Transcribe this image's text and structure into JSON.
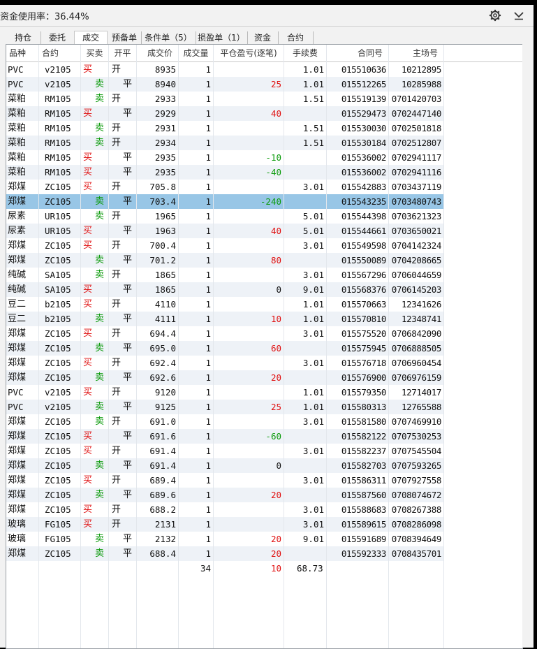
{
  "window": {
    "title": "资金使用率：36.44%",
    "icons": [
      "gear-icon",
      "chevron-down-icon"
    ]
  },
  "tabs": [
    {
      "label": "持仓",
      "active": false
    },
    {
      "label": "委托",
      "active": false
    },
    {
      "label": "成交",
      "active": true
    },
    {
      "label": "预备单",
      "active": false
    },
    {
      "label": "条件单（5）",
      "active": false
    },
    {
      "label": "损盈单（1）",
      "active": false
    },
    {
      "label": "资金",
      "active": false
    },
    {
      "label": "合约",
      "active": false
    }
  ],
  "table": {
    "columns": [
      "品种",
      "合约",
      "买卖",
      "开平",
      "成交价",
      "成交量",
      "平仓盈亏(逐笔)",
      "手续费",
      "合同号",
      "主场号"
    ],
    "rows": [
      {
        "product": "PVC",
        "contract": "v2105",
        "side": "买",
        "oc": "开",
        "price": "8935",
        "qty": "1",
        "pnl": "",
        "fee": "1.01",
        "order_no": "015510636",
        "match_no": "10212895"
      },
      {
        "product": "PVC",
        "contract": "v2105",
        "side": "卖",
        "oc": "平",
        "price": "8940",
        "qty": "1",
        "pnl": "25",
        "fee": "1.01",
        "order_no": "015512265",
        "match_no": "10285988"
      },
      {
        "product": "菜粕",
        "contract": "RM105",
        "side": "卖",
        "oc": "开",
        "price": "2933",
        "qty": "1",
        "pnl": "",
        "fee": "1.51",
        "order_no": "015519139",
        "match_no": "0701420703"
      },
      {
        "product": "菜粕",
        "contract": "RM105",
        "side": "买",
        "oc": "平",
        "price": "2929",
        "qty": "1",
        "pnl": "40",
        "fee": "",
        "order_no": "015529473",
        "match_no": "0702447140"
      },
      {
        "product": "菜粕",
        "contract": "RM105",
        "side": "卖",
        "oc": "开",
        "price": "2931",
        "qty": "1",
        "pnl": "",
        "fee": "1.51",
        "order_no": "015530030",
        "match_no": "0702501818"
      },
      {
        "product": "菜粕",
        "contract": "RM105",
        "side": "卖",
        "oc": "开",
        "price": "2934",
        "qty": "1",
        "pnl": "",
        "fee": "1.51",
        "order_no": "015530184",
        "match_no": "0702512807"
      },
      {
        "product": "菜粕",
        "contract": "RM105",
        "side": "买",
        "oc": "平",
        "price": "2935",
        "qty": "1",
        "pnl": "-10",
        "fee": "",
        "order_no": "015536002",
        "match_no": "0702941117"
      },
      {
        "product": "菜粕",
        "contract": "RM105",
        "side": "买",
        "oc": "平",
        "price": "2935",
        "qty": "1",
        "pnl": "-40",
        "fee": "",
        "order_no": "015536002",
        "match_no": "0702941116"
      },
      {
        "product": "郑煤",
        "contract": "ZC105",
        "side": "买",
        "oc": "开",
        "price": "705.8",
        "qty": "1",
        "pnl": "",
        "fee": "3.01",
        "order_no": "015542883",
        "match_no": "0703437119"
      },
      {
        "product": "郑煤",
        "contract": "ZC105",
        "side": "卖",
        "oc": "平",
        "price": "703.4",
        "qty": "1",
        "pnl": "-240",
        "fee": "",
        "order_no": "015543235",
        "match_no": "0703480743",
        "selected": true
      },
      {
        "product": "尿素",
        "contract": "UR105",
        "side": "卖",
        "oc": "开",
        "price": "1965",
        "qty": "1",
        "pnl": "",
        "fee": "5.01",
        "order_no": "015544398",
        "match_no": "0703621323"
      },
      {
        "product": "尿素",
        "contract": "UR105",
        "side": "买",
        "oc": "平",
        "price": "1963",
        "qty": "1",
        "pnl": "40",
        "fee": "5.01",
        "order_no": "015544661",
        "match_no": "0703650021"
      },
      {
        "product": "郑煤",
        "contract": "ZC105",
        "side": "买",
        "oc": "开",
        "price": "700.4",
        "qty": "1",
        "pnl": "",
        "fee": "3.01",
        "order_no": "015549598",
        "match_no": "0704142324"
      },
      {
        "product": "郑煤",
        "contract": "ZC105",
        "side": "卖",
        "oc": "平",
        "price": "701.2",
        "qty": "1",
        "pnl": "80",
        "fee": "",
        "order_no": "015550089",
        "match_no": "0704208665"
      },
      {
        "product": "纯碱",
        "contract": "SA105",
        "side": "卖",
        "oc": "开",
        "price": "1865",
        "qty": "1",
        "pnl": "",
        "fee": "3.01",
        "order_no": "015567296",
        "match_no": "0706044659"
      },
      {
        "product": "纯碱",
        "contract": "SA105",
        "side": "买",
        "oc": "平",
        "price": "1865",
        "qty": "1",
        "pnl": "0",
        "fee": "9.01",
        "order_no": "015568376",
        "match_no": "0706145203"
      },
      {
        "product": "豆二",
        "contract": "b2105",
        "side": "买",
        "oc": "开",
        "price": "4110",
        "qty": "1",
        "pnl": "",
        "fee": "1.01",
        "order_no": "015570663",
        "match_no": "12341626"
      },
      {
        "product": "豆二",
        "contract": "b2105",
        "side": "卖",
        "oc": "平",
        "price": "4111",
        "qty": "1",
        "pnl": "10",
        "fee": "1.01",
        "order_no": "015570810",
        "match_no": "12348741"
      },
      {
        "product": "郑煤",
        "contract": "ZC105",
        "side": "买",
        "oc": "开",
        "price": "694.4",
        "qty": "1",
        "pnl": "",
        "fee": "3.01",
        "order_no": "015575520",
        "match_no": "0706842090"
      },
      {
        "product": "郑煤",
        "contract": "ZC105",
        "side": "卖",
        "oc": "平",
        "price": "695.0",
        "qty": "1",
        "pnl": "60",
        "fee": "",
        "order_no": "015575945",
        "match_no": "0706888505"
      },
      {
        "product": "郑煤",
        "contract": "ZC105",
        "side": "买",
        "oc": "开",
        "price": "692.4",
        "qty": "1",
        "pnl": "",
        "fee": "3.01",
        "order_no": "015576718",
        "match_no": "0706960454"
      },
      {
        "product": "郑煤",
        "contract": "ZC105",
        "side": "卖",
        "oc": "平",
        "price": "692.6",
        "qty": "1",
        "pnl": "20",
        "fee": "",
        "order_no": "015576900",
        "match_no": "0706976159"
      },
      {
        "product": "PVC",
        "contract": "v2105",
        "side": "买",
        "oc": "开",
        "price": "9120",
        "qty": "1",
        "pnl": "",
        "fee": "1.01",
        "order_no": "015579350",
        "match_no": "12714017"
      },
      {
        "product": "PVC",
        "contract": "v2105",
        "side": "卖",
        "oc": "平",
        "price": "9125",
        "qty": "1",
        "pnl": "25",
        "fee": "1.01",
        "order_no": "015580313",
        "match_no": "12765588"
      },
      {
        "product": "郑煤",
        "contract": "ZC105",
        "side": "卖",
        "oc": "开",
        "price": "691.0",
        "qty": "1",
        "pnl": "",
        "fee": "3.01",
        "order_no": "015581580",
        "match_no": "0707469910"
      },
      {
        "product": "郑煤",
        "contract": "ZC105",
        "side": "买",
        "oc": "平",
        "price": "691.6",
        "qty": "1",
        "pnl": "-60",
        "fee": "",
        "order_no": "015582122",
        "match_no": "0707530253"
      },
      {
        "product": "郑煤",
        "contract": "ZC105",
        "side": "买",
        "oc": "开",
        "price": "691.4",
        "qty": "1",
        "pnl": "",
        "fee": "3.01",
        "order_no": "015582237",
        "match_no": "0707545504"
      },
      {
        "product": "郑煤",
        "contract": "ZC105",
        "side": "卖",
        "oc": "平",
        "price": "691.4",
        "qty": "1",
        "pnl": "0",
        "fee": "",
        "order_no": "015582703",
        "match_no": "0707593265"
      },
      {
        "product": "郑煤",
        "contract": "ZC105",
        "side": "买",
        "oc": "开",
        "price": "689.4",
        "qty": "1",
        "pnl": "",
        "fee": "3.01",
        "order_no": "015586311",
        "match_no": "0707927558"
      },
      {
        "product": "郑煤",
        "contract": "ZC105",
        "side": "卖",
        "oc": "平",
        "price": "689.6",
        "qty": "1",
        "pnl": "20",
        "fee": "",
        "order_no": "015587560",
        "match_no": "0708074672"
      },
      {
        "product": "郑煤",
        "contract": "ZC105",
        "side": "买",
        "oc": "开",
        "price": "688.2",
        "qty": "1",
        "pnl": "",
        "fee": "3.01",
        "order_no": "015588683",
        "match_no": "0708267388"
      },
      {
        "product": "玻璃",
        "contract": "FG105",
        "side": "买",
        "oc": "开",
        "price": "2131",
        "qty": "1",
        "pnl": "",
        "fee": "3.01",
        "order_no": "015589615",
        "match_no": "0708286098"
      },
      {
        "product": "玻璃",
        "contract": "FG105",
        "side": "卖",
        "oc": "平",
        "price": "2132",
        "qty": "1",
        "pnl": "20",
        "fee": "9.01",
        "order_no": "015591689",
        "match_no": "0708394649"
      },
      {
        "product": "郑煤",
        "contract": "ZC105",
        "side": "卖",
        "oc": "平",
        "price": "688.4",
        "qty": "1",
        "pnl": "20",
        "fee": "",
        "order_no": "015592333",
        "match_no": "0708435701"
      }
    ],
    "totals": {
      "qty": "34",
      "pnl": "10",
      "fee": "68.73"
    }
  },
  "colors": {
    "buy": "#e01010",
    "sell": "#0a9a0a",
    "selected_row": "#98c6e6",
    "alt_row": "#eef2f7"
  }
}
